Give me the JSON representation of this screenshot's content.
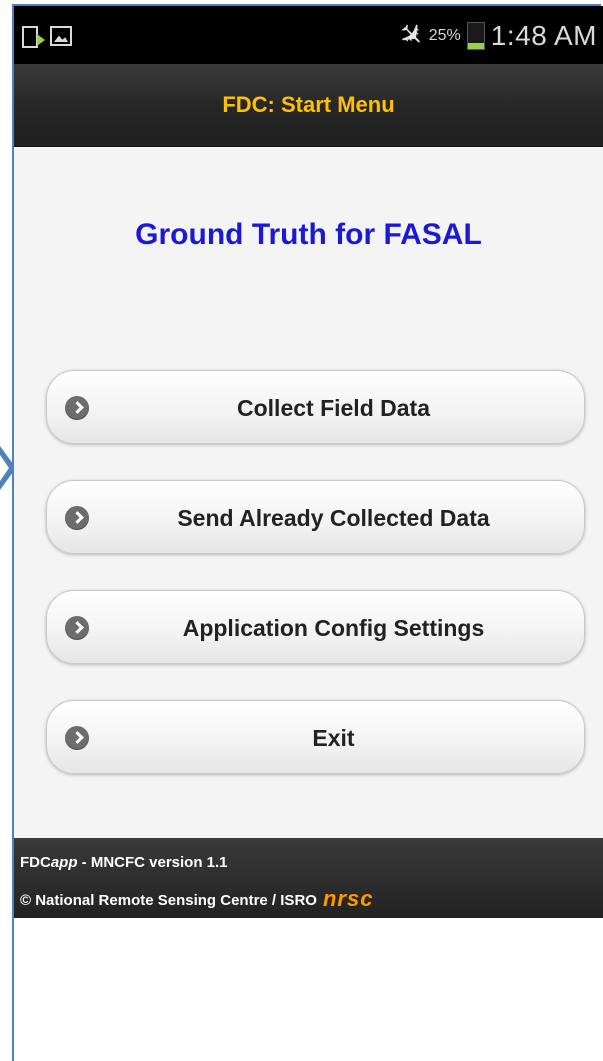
{
  "status_bar": {
    "left_icons": [
      "phone-update-icon",
      "image-icon"
    ],
    "airplane_icon": "airplane-icon",
    "battery_percent": "25%",
    "battery_level": 0.25,
    "battery_color": "#9bd042",
    "time": "1:48 AM"
  },
  "title_bar": {
    "title": "FDC: Start Menu",
    "title_color": "#ffc000"
  },
  "heading": {
    "text": "Ground Truth for FASAL",
    "color": "#1a1ad6"
  },
  "menu": {
    "items": [
      {
        "label": "Collect Field Data",
        "icon": "chevron-right-circle-icon"
      },
      {
        "label": "Send Already Collected Data",
        "icon": "chevron-right-circle-icon"
      },
      {
        "label": "Application Config Settings",
        "icon": "chevron-right-circle-icon"
      },
      {
        "label": "Exit",
        "icon": "chevron-right-circle-icon"
      }
    ]
  },
  "footer": {
    "app_prefix": "FDC",
    "app_italic": "app",
    "version_text": " - MNCFC version 1.1",
    "copyright": "© National Remote Sensing Centre / ISRO",
    "logo_text": "nrsc",
    "logo_color": "#ff9900"
  },
  "annotation": {
    "pointer_icon": "pointer-arrow-icon",
    "frame_color": "#4f81bd"
  }
}
